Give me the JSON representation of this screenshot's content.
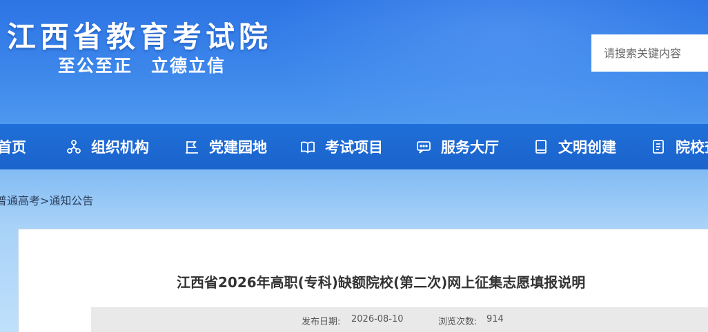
{
  "header": {
    "site_title": "江西省教育考试院",
    "slogan": "至公至正　立德立信",
    "search_placeholder": "请搜索关键内容"
  },
  "nav": {
    "items": [
      {
        "label": "首页",
        "icon": "home-icon"
      },
      {
        "label": "组织机构",
        "icon": "org-chart-icon"
      },
      {
        "label": "党建园地",
        "icon": "party-flag-icon"
      },
      {
        "label": "考试项目",
        "icon": "book-icon"
      },
      {
        "label": "服务大厅",
        "icon": "chat-icon"
      },
      {
        "label": "文明创建",
        "icon": "notebook-icon"
      },
      {
        "label": "院校查",
        "icon": "document-icon"
      }
    ]
  },
  "breadcrumb": {
    "items": [
      "普通高考",
      "通知公告"
    ],
    "separator": ">"
  },
  "article": {
    "title": "江西省2026年高职(专科)缺额院校(第二次)网上征集志愿填报说明",
    "publish_label": "发布日期:",
    "publish_date": "2026-08-10",
    "views_label": "浏览次数:",
    "views": "914"
  },
  "colors": {
    "header_blue": "#2d74e4",
    "nav_blue": "#1f6fd8",
    "text_dark": "#333333"
  }
}
